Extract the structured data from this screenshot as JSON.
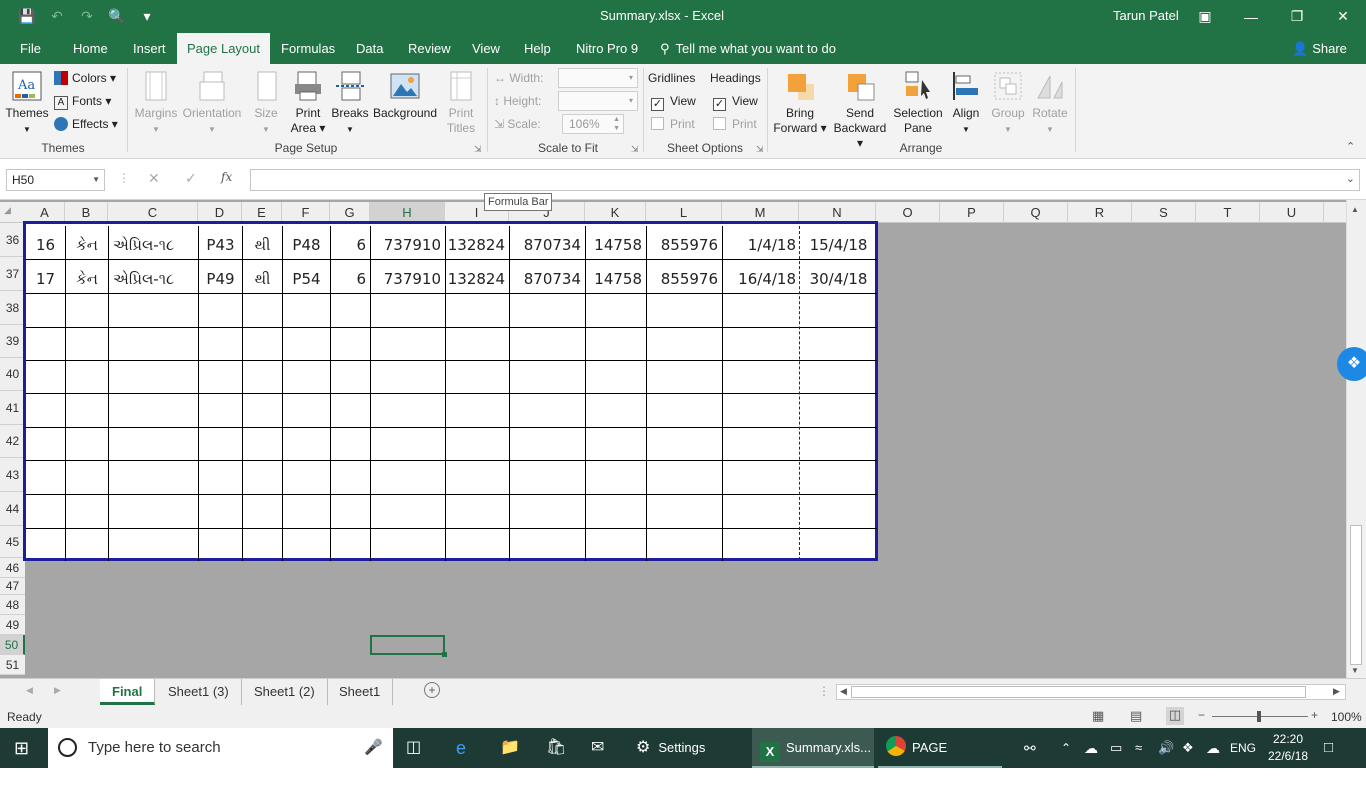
{
  "titlebar": {
    "doc_title": "Summary.xlsx  -  Excel",
    "user": "Tarun Patel"
  },
  "tabs": [
    "File",
    "Home",
    "Insert",
    "Page Layout",
    "Formulas",
    "Data",
    "Review",
    "View",
    "Help",
    "Nitro Pro 9"
  ],
  "active_tab": "Page Layout",
  "tell_me": "Tell me what you want to do",
  "share": "Share",
  "ribbon": {
    "themes": {
      "themes": "Themes",
      "colors": "Colors",
      "fonts": "Fonts",
      "effects": "Effects",
      "group": "Themes"
    },
    "page_setup": {
      "margins": "Margins",
      "orientation": "Orientation",
      "size": "Size",
      "print_area_1": "Print",
      "print_area_2": "Area",
      "breaks": "Breaks",
      "background": "Background",
      "print_titles_1": "Print",
      "print_titles_2": "Titles",
      "group": "Page Setup"
    },
    "scale_to_fit": {
      "width": "Width:",
      "height": "Height:",
      "scale": "Scale:",
      "scale_value": "106%",
      "group": "Scale to Fit"
    },
    "sheet_options": {
      "gridlines": "Gridlines",
      "headings": "Headings",
      "view": "View",
      "print": "Print",
      "group": "Sheet Options"
    },
    "arrange": {
      "bring_forward_1": "Bring",
      "bring_forward_2": "Forward",
      "send_backward_1": "Send",
      "send_backward_2": "Backward",
      "selection_pane_1": "Selection",
      "selection_pane_2": "Pane",
      "align": "Align",
      "group_btn": "Group",
      "rotate": "Rotate",
      "group": "Arrange"
    }
  },
  "formula_bar": {
    "name_box": "H50",
    "fx": "fx",
    "tooltip": "Formula Bar",
    "value": ""
  },
  "columns": [
    "A",
    "B",
    "C",
    "D",
    "E",
    "F",
    "G",
    "H",
    "I",
    "J",
    "K",
    "L",
    "M",
    "N",
    "O",
    "P",
    "Q",
    "R",
    "S",
    "T",
    "U"
  ],
  "selected_column": "H",
  "rows": [
    "36",
    "37",
    "38",
    "39",
    "40",
    "41",
    "42",
    "43",
    "44",
    "45",
    "46",
    "47",
    "48",
    "49",
    "50",
    "51"
  ],
  "selected_row": "50",
  "data_rows": [
    [
      "16",
      "કેન",
      "એપ્રિલ-૧૮",
      "P43",
      "થી",
      "P48",
      "6",
      "737910",
      "132824",
      "870734",
      "14758",
      "855976",
      "1/4/18",
      "15/4/18"
    ],
    [
      "17",
      "કેન",
      "એપ્રિલ-૧૮",
      "P49",
      "થી",
      "P54",
      "6",
      "737910",
      "132824",
      "870734",
      "14758",
      "855976",
      "16/4/18",
      "30/4/18"
    ]
  ],
  "sheet_tabs": [
    "Final",
    "Sheet1 (3)",
    "Sheet1 (2)",
    "Sheet1"
  ],
  "active_sheet": "Final",
  "status": {
    "ready": "Ready",
    "zoom": "100%"
  },
  "taskbar": {
    "search": "Type here to search",
    "settings": "Settings",
    "excel": "Summary.xls...",
    "chrome": "PAGE LAYOU...",
    "lang": "ENG",
    "time": "22:20",
    "date": "22/6/18"
  },
  "colors": {
    "excel_green": "#217346",
    "page_border": "#1e1e9a",
    "taskbar": "#1d3b34"
  }
}
